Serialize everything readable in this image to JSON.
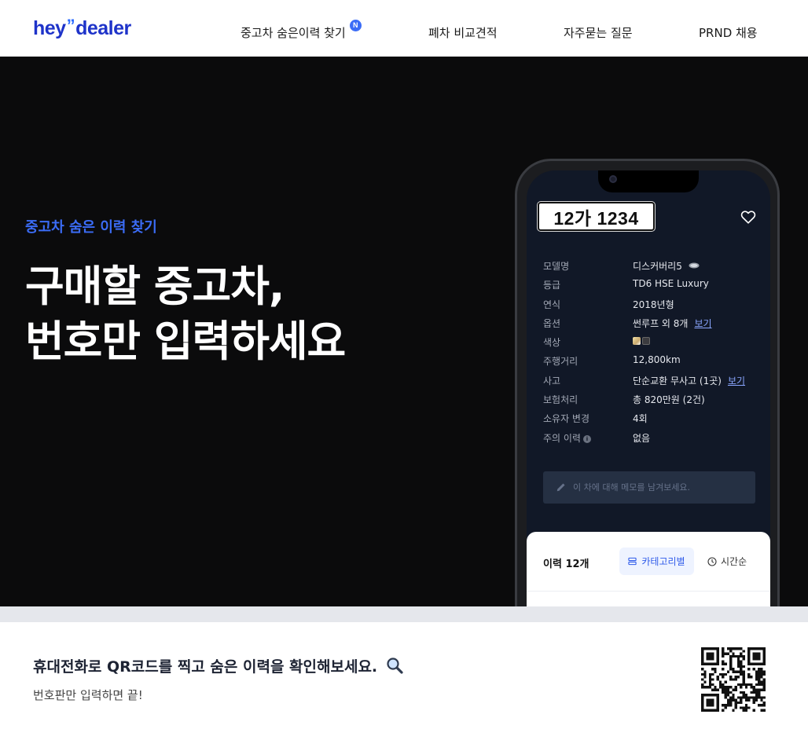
{
  "header": {
    "logo_left": "hey",
    "logo_quote": "”",
    "logo_right": "dealer",
    "nav": [
      {
        "label": "중고차 숨은이력 찾기",
        "badge": "N"
      },
      {
        "label": "폐차 비교견적"
      },
      {
        "label": "자주묻는 질문"
      },
      {
        "label": "PRND 채용"
      }
    ]
  },
  "hero": {
    "kicker": "중고차 숨은 이력 찾기",
    "title_line1": "구매할 중고차,",
    "title_line2": "번호만 입력하세요"
  },
  "phone": {
    "plate": "12가 1234",
    "rows": [
      {
        "key": "모델명",
        "value": "디스커버리5"
      },
      {
        "key": "등급",
        "value": "TD6 HSE Luxury"
      },
      {
        "key": "연식",
        "value": "2018년형"
      },
      {
        "key": "옵션",
        "value": "썬루프 외 8개",
        "link": "보기"
      },
      {
        "key": "색상",
        "value": ""
      },
      {
        "key": "주행거리",
        "value": "12,800km"
      },
      {
        "key": "사고",
        "value": "단순교환 무사고 (1곳)",
        "link": "보기"
      },
      {
        "key": "보험처리",
        "value": "총 820만원 (2건)"
      },
      {
        "key": "소유자 변경",
        "value": "4회"
      },
      {
        "key": "주의 이력",
        "value": "없음",
        "info": "i"
      }
    ],
    "memo_placeholder": "이 차에 대해 메모를 남겨보세요.",
    "history_title": "이력 12개",
    "category_button": "카테고리별",
    "time_button": "시간순",
    "colors": {
      "swatch1": "#e9d59a",
      "swatch2": "#3b3b3f"
    }
  },
  "footer": {
    "title": "휴대전화로 QR코드를 찍고 숨은 이력을 확인해보세요.",
    "title_icon": "magnifier-icon",
    "subtitle": "번호판만 입력하면 끝!"
  },
  "colors": {
    "brand": "#1e33c9",
    "accent": "#3b6cf6",
    "hero_bg": "#0b0b0c"
  }
}
